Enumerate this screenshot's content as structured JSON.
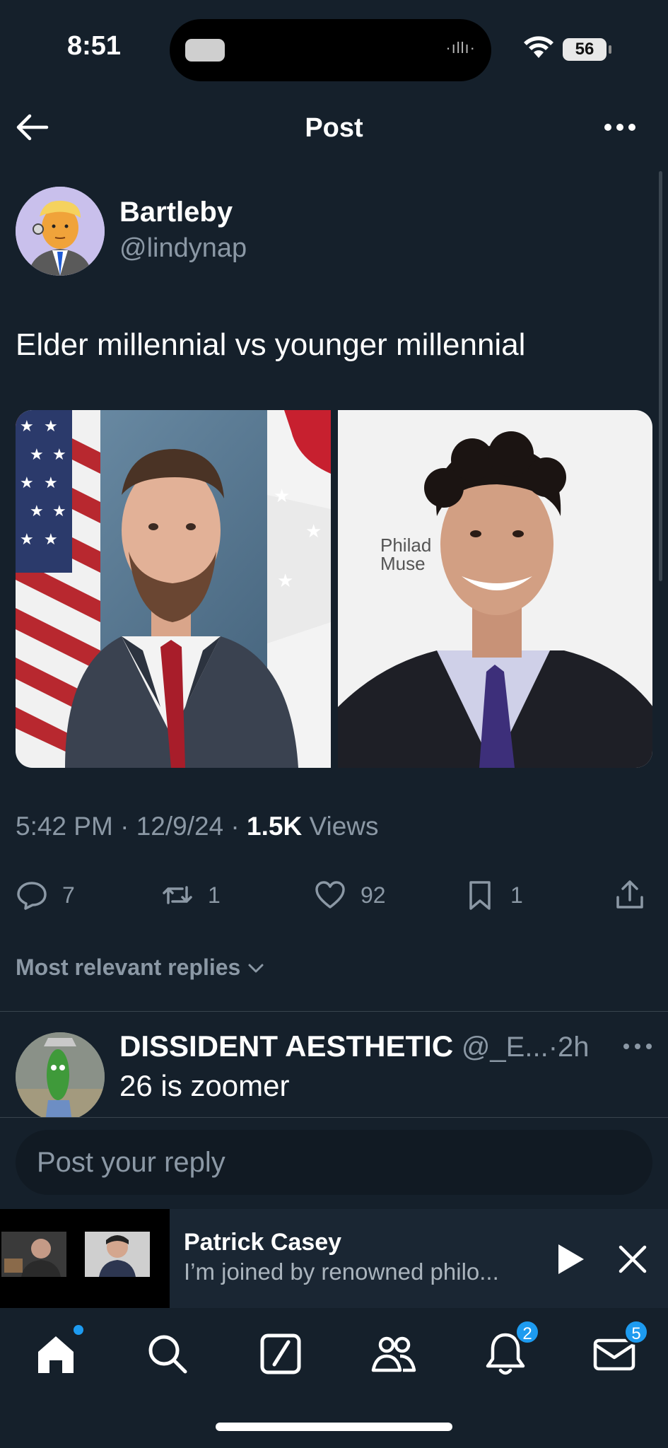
{
  "status_bar": {
    "time": "8:51",
    "battery": "56"
  },
  "header": {
    "title": "Post"
  },
  "post": {
    "author_name": "Bartleby",
    "author_handle": "@lindynap",
    "text": "Elder millennial vs younger millennial",
    "photo_right_sign": "Philad\nMuse",
    "time": "5:42 PM",
    "date": "12/9/24",
    "views_count": "1.5K",
    "views_label": "Views",
    "sep": "·"
  },
  "actions": {
    "replies": "7",
    "reposts": "1",
    "likes": "92",
    "bookmarks": "1"
  },
  "sort": {
    "label": "Most relevant replies"
  },
  "reply": {
    "name": "DISSIDENT AESTHETIC",
    "handle": "@_E...",
    "age": "2h",
    "sep": "·",
    "text": "26 is zoomer"
  },
  "compose": {
    "placeholder": "Post your reply"
  },
  "player": {
    "title": "Patrick Casey",
    "subtitle": "I’m joined by renowned philo..."
  },
  "tabbar": {
    "notifications_badge": "2",
    "messages_badge": "5"
  },
  "colors": {
    "background": "#15202b",
    "accent": "#1d9bf0",
    "muted": "#8b98a5"
  }
}
